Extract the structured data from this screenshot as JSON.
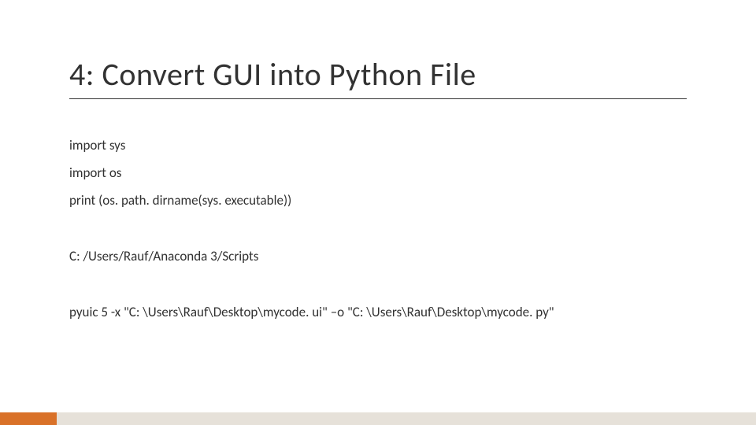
{
  "slide": {
    "title": "4: Convert GUI into Python File",
    "lines": {
      "l1": "import sys",
      "l2": "import os",
      "l3": "print (os. path. dirname(sys. executable))",
      "l4": "C: /Users/Rauf/Anaconda 3/Scripts",
      "l5": "pyuic 5 -x \"C: \\Users\\Rauf\\Desktop\\mycode. ui\" –o \"C: \\Users\\Rauf\\Desktop\\mycode. py\""
    }
  }
}
